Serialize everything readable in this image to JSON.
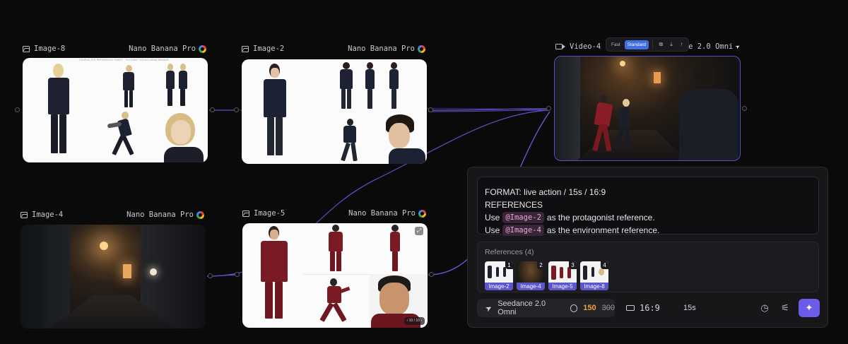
{
  "nodes": {
    "image8": {
      "title": "Image-8",
      "model": "Nano Banana Pro",
      "sheet_caption": "CHARACTER REFERENCE SHEET · ELEGANT YOUNG ASIAN WOMAN"
    },
    "image2": {
      "title": "Image-2",
      "model": "Nano Banana Pro"
    },
    "image4": {
      "title": "Image-4",
      "model": "Nano Banana Pro"
    },
    "image5": {
      "title": "Image-5",
      "model": "Nano Banana Pro",
      "pager": "10 / 10"
    },
    "video4": {
      "title": "Video-4",
      "model": "Seedance 2.0 Omni",
      "model_visible": "ce 2.0 Omni"
    }
  },
  "video_toolbar": {
    "fast": "Fast",
    "standard": "Standard",
    "active": "Standard"
  },
  "prompt": {
    "line1": "FORMAT: live action / 15s / 16:9",
    "line2": "REFERENCES",
    "line3_pre": "Use",
    "line3_tag": "@Image-2",
    "line3_post": "as the protagonist reference.",
    "line4_pre": "Use",
    "line4_tag": "@Image-4",
    "line4_post": "as the environment reference."
  },
  "references": {
    "title": "References (4)",
    "items": [
      {
        "num": "1",
        "label": "Image-2"
      },
      {
        "num": "2",
        "label": "Image-4"
      },
      {
        "num": "3",
        "label": "Image-5"
      },
      {
        "num": "4",
        "label": "Image-8"
      }
    ]
  },
  "controls": {
    "model": "Seedance 2.0 Omni",
    "cost": "150",
    "cost_original": "300",
    "aspect": "16:9",
    "duration": "15s"
  },
  "colors": {
    "accent": "#6c5ce7",
    "tag_bg": "#3a2437",
    "cost": "#f0a336",
    "wire": "#5b4fd0"
  },
  "icons": [
    "image-icon",
    "video-icon",
    "google-icon",
    "seedance-icon",
    "credit-icon",
    "aspect-icon",
    "history-icon",
    "magic-wand-icon",
    "sparkle-icon",
    "copy-icon",
    "download-icon",
    "share-icon",
    "expand-icon"
  ]
}
